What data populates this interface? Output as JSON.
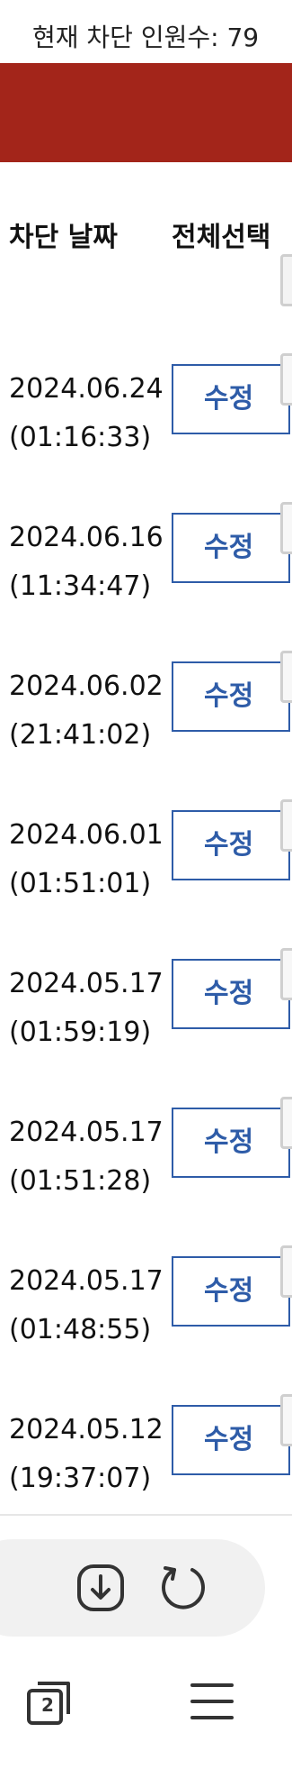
{
  "header": {
    "count_label": "현재 차단 인원수: 79"
  },
  "table": {
    "columns": {
      "date": "차단 날짜",
      "select_all": "전체선택"
    },
    "rows": [
      {
        "date": "2024.06.24",
        "time": "(01:16:33)",
        "edit_label": "수정"
      },
      {
        "date": "2024.06.16",
        "time": "(11:34:47)",
        "edit_label": "수정"
      },
      {
        "date": "2024.06.02",
        "time": "(21:41:02)",
        "edit_label": "수정"
      },
      {
        "date": "2024.06.01",
        "time": "(01:51:01)",
        "edit_label": "수정"
      },
      {
        "date": "2024.05.17",
        "time": "(01:59:19)",
        "edit_label": "수정"
      },
      {
        "date": "2024.05.17",
        "time": "(01:51:28)",
        "edit_label": "수정"
      },
      {
        "date": "2024.05.17",
        "time": "(01:48:55)",
        "edit_label": "수정"
      },
      {
        "date": "2024.05.12",
        "time": "(19:37:07)",
        "edit_label": "수정"
      }
    ]
  },
  "browser_bar": {
    "tab_count": "2",
    "icons": [
      "download-icon",
      "reload-icon",
      "tabs-icon",
      "menu-icon"
    ]
  },
  "colors": {
    "banner": "#a3251a",
    "button_accent": "#2e5ca8"
  }
}
